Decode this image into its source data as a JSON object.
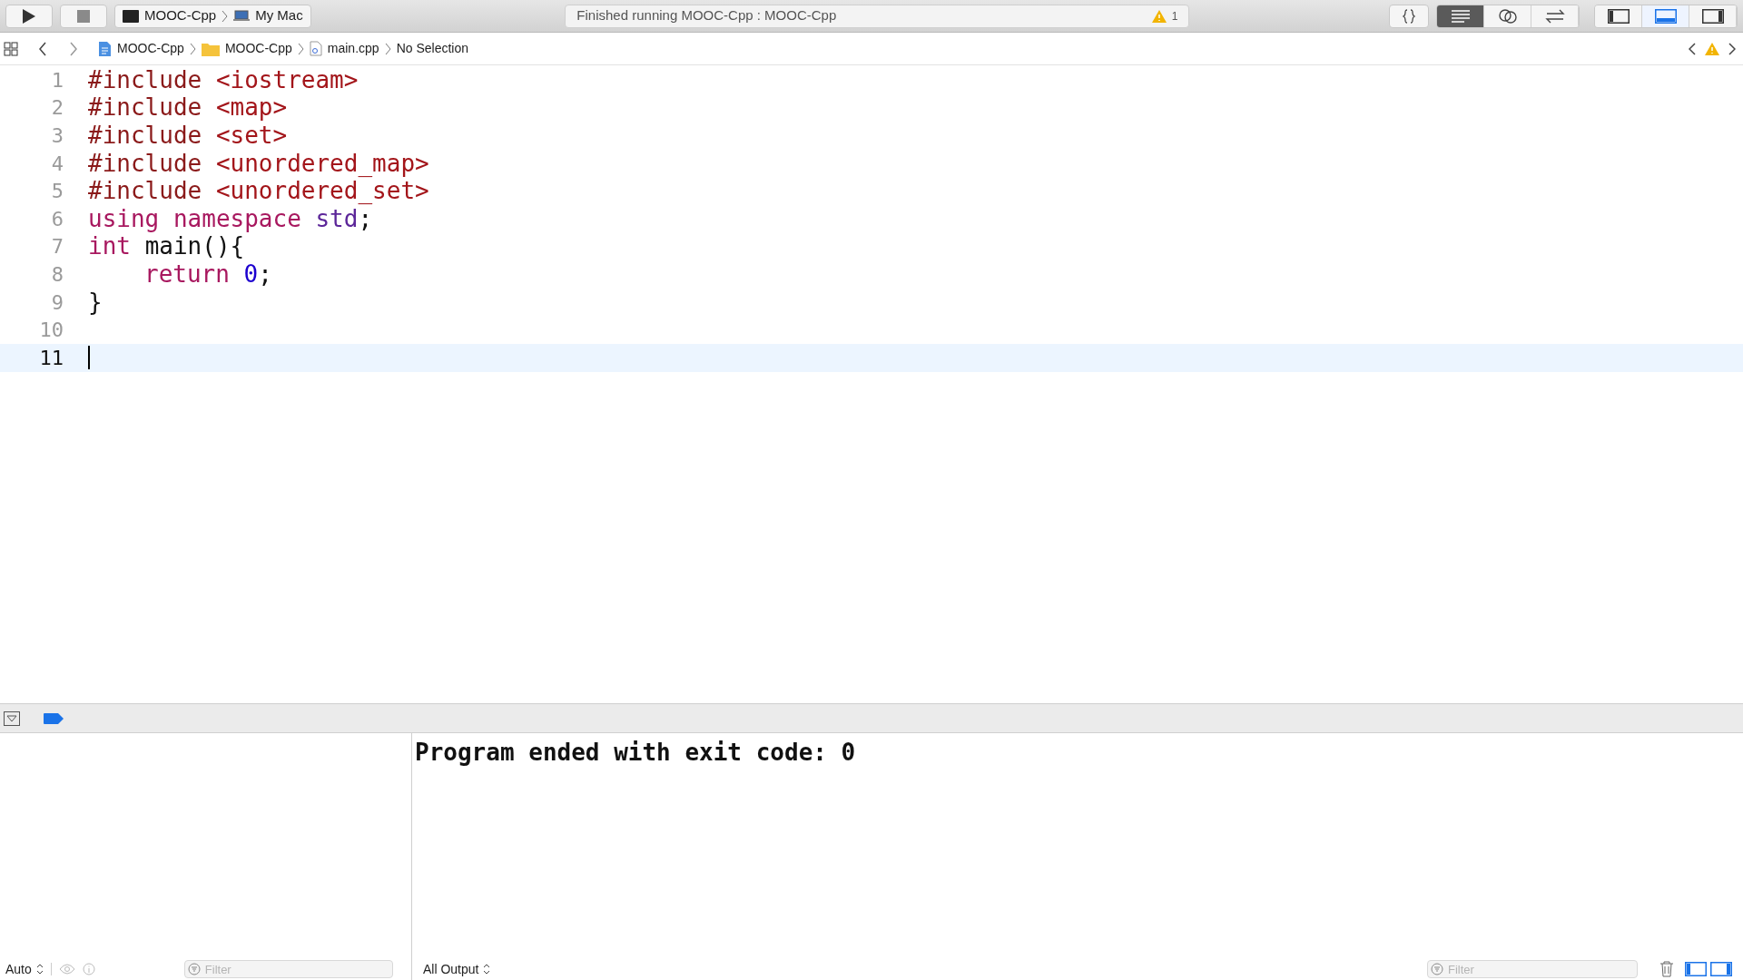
{
  "toolbar": {
    "scheme": "MOOC-Cpp",
    "destination": "My Mac",
    "activity": "Finished running MOOC-Cpp : MOOC-Cpp",
    "warning_count": "1",
    "editor_modes": [
      {
        "kind": "braces",
        "selected": false
      },
      {
        "kind": "standard",
        "selected": true
      },
      {
        "kind": "assistant",
        "selected": false
      },
      {
        "kind": "version",
        "selected": false
      }
    ],
    "panels": [
      {
        "kind": "left",
        "on": false
      },
      {
        "kind": "bottom",
        "on": true
      },
      {
        "kind": "right",
        "on": false
      }
    ]
  },
  "jump_bar": {
    "items": [
      {
        "kind": "project",
        "label": "MOOC-Cpp"
      },
      {
        "kind": "folder",
        "label": "MOOC-Cpp"
      },
      {
        "kind": "file",
        "label": "main.cpp"
      },
      {
        "kind": "plain",
        "label": "No Selection"
      }
    ]
  },
  "editor": {
    "lines": [
      {
        "number": "1",
        "current": false,
        "indented": false,
        "tokens": [
          {
            "kind": "directive",
            "text": "#include "
          },
          {
            "kind": "string",
            "text": "<iostream>"
          }
        ]
      },
      {
        "number": "2",
        "current": false,
        "indented": false,
        "tokens": [
          {
            "kind": "directive",
            "text": "#include "
          },
          {
            "kind": "string",
            "text": "<map>"
          }
        ]
      },
      {
        "number": "3",
        "current": false,
        "indented": false,
        "tokens": [
          {
            "kind": "directive",
            "text": "#include "
          },
          {
            "kind": "string",
            "text": "<set>"
          }
        ]
      },
      {
        "number": "4",
        "current": false,
        "indented": false,
        "tokens": [
          {
            "kind": "directive",
            "text": "#include "
          },
          {
            "kind": "string",
            "text": "<unordered_map>"
          }
        ]
      },
      {
        "number": "5",
        "current": false,
        "indented": false,
        "tokens": [
          {
            "kind": "directive",
            "text": "#include "
          },
          {
            "kind": "string",
            "text": "<unordered_set>"
          }
        ]
      },
      {
        "number": "6",
        "current": false,
        "indented": false,
        "tokens": [
          {
            "kind": "keyword",
            "text": "using namespace "
          },
          {
            "kind": "type",
            "text": "std"
          },
          {
            "kind": "plain",
            "text": ";"
          }
        ]
      },
      {
        "number": "7",
        "current": false,
        "indented": false,
        "tokens": [
          {
            "kind": "keyword",
            "text": "int "
          },
          {
            "kind": "plain",
            "text": "main(){"
          }
        ]
      },
      {
        "number": "8",
        "current": false,
        "indented": true,
        "tokens": [
          {
            "kind": "keyword",
            "text": "return "
          },
          {
            "kind": "number",
            "text": "0"
          },
          {
            "kind": "plain",
            "text": ";"
          }
        ]
      },
      {
        "number": "9",
        "current": false,
        "indented": false,
        "tokens": [
          {
            "kind": "plain",
            "text": "}"
          }
        ]
      },
      {
        "number": "10",
        "current": false
      },
      {
        "number": "11",
        "current": true,
        "indented": false
      }
    ]
  },
  "debug": {
    "variables_mode": "Auto",
    "variables_filter": {
      "placeholder": "Filter"
    },
    "console_output": "Program ended with exit code: 0",
    "output_mode": "All Output",
    "console_filter": {
      "placeholder": "Filter"
    },
    "split": [
      {
        "kind": "left",
        "on": true
      },
      {
        "kind": "right",
        "on": true
      }
    ]
  }
}
